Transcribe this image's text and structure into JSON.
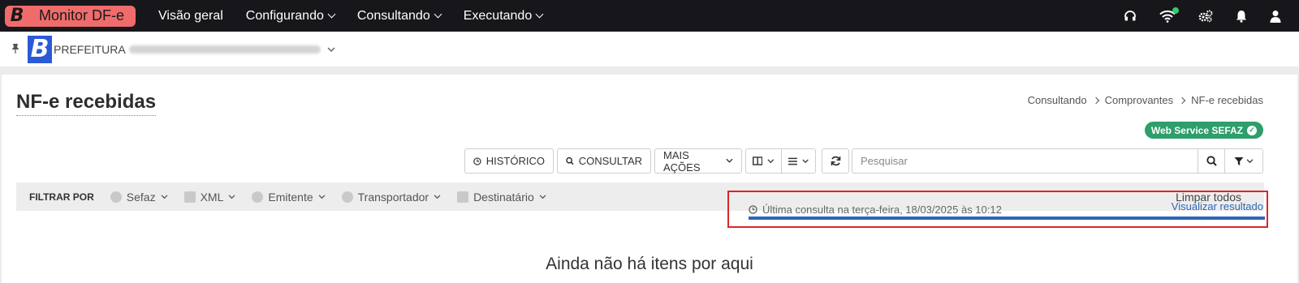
{
  "topbar": {
    "brand_letter": "B",
    "brand_name": "Monitor DF-e",
    "nav": [
      "Visão geral",
      "Configurando",
      "Consultando",
      "Executando"
    ],
    "icons": [
      "headset-icon",
      "wifi-icon",
      "gears-icon",
      "bell-icon",
      "user-icon"
    ]
  },
  "orgbar": {
    "logo_letter": "B",
    "org_name": "PREFEITURA"
  },
  "page": {
    "title": "NF-e recebidas",
    "breadcrumb": [
      "Consultando",
      "Comprovantes",
      "NF-e recebidas"
    ],
    "ws_badge": "Web Service SEFAZ",
    "ws_badge_color": "#2e9e6a"
  },
  "toolbar": {
    "history_label": "HISTÓRICO",
    "query_label": "CONSULTAR",
    "more_actions_label": "MAIS AÇÕES",
    "search_placeholder": "Pesquisar"
  },
  "filters": {
    "label": "FILTRAR POR",
    "items": [
      "Sefaz",
      "XML",
      "Emitente",
      "Transportador",
      "Destinatário"
    ],
    "clear_label": "Limpar todos"
  },
  "last_query": {
    "text": "Última consulta na terça-feira, 18/03/2025 às 10:12",
    "view_result": "Visualizar resultado",
    "progress_percent": 100,
    "highlight_color": "#d9262c"
  },
  "empty_state": {
    "message": "Ainda não há itens por aqui"
  }
}
